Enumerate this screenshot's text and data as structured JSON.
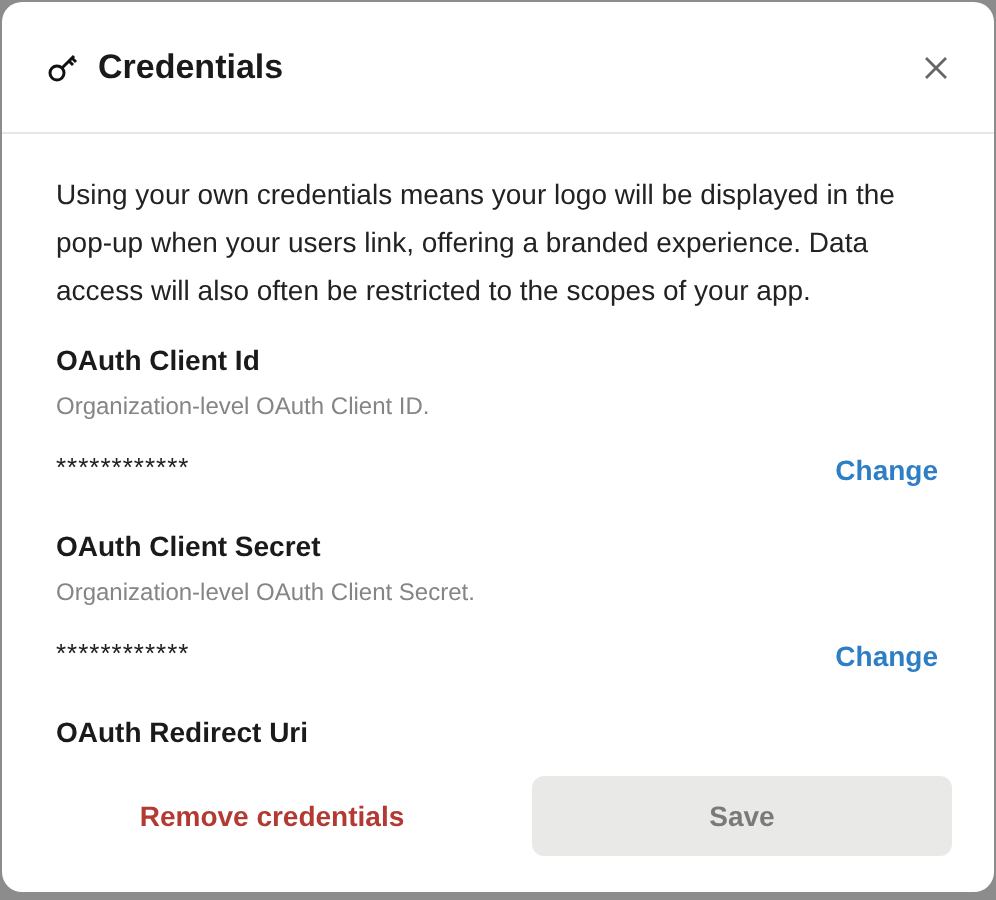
{
  "dialog": {
    "title": "Credentials"
  },
  "intro": "Using your own credentials means your logo will be displayed in the pop-up when your users link, offering a branded experience. Data access will also often be restricted to the scopes of your app.",
  "fields": [
    {
      "label": "OAuth Client Id",
      "description": "Organization-level OAuth Client ID.",
      "value": "************",
      "action": "Change"
    },
    {
      "label": "OAuth Client Secret",
      "description": "Organization-level OAuth Client Secret.",
      "value": "************",
      "action": "Change"
    },
    {
      "label": "OAuth Redirect Uri"
    }
  ],
  "footer": {
    "remove": "Remove credentials",
    "save": {
      "label": "Save",
      "disabled": true
    }
  }
}
